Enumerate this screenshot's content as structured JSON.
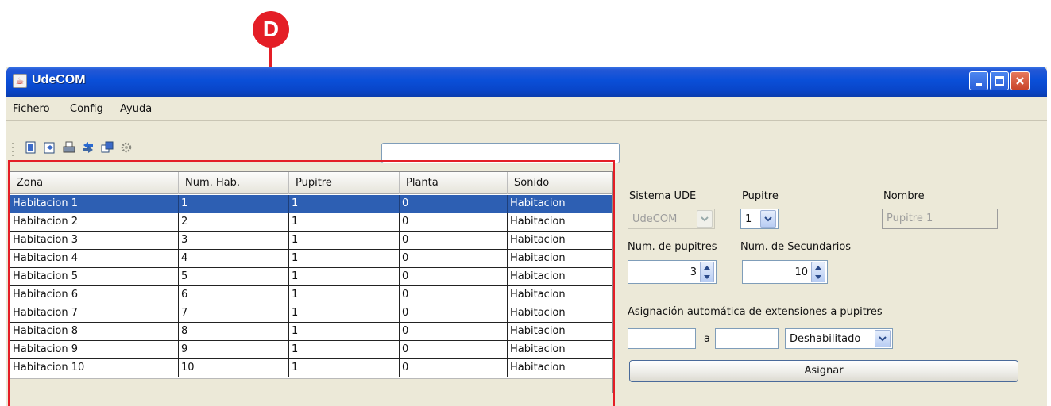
{
  "annotation": {
    "badge_label": "D"
  },
  "window": {
    "title": "UdeCOM",
    "controls": [
      "minimize-icon",
      "maximize-icon",
      "close-icon"
    ]
  },
  "menu": {
    "items": [
      "Fichero",
      "Config",
      "Ayuda"
    ]
  },
  "toolbar": {
    "icons": [
      "new-document-icon",
      "open-file-icon",
      "print-icon",
      "sync-icon",
      "windows-icon",
      "settings-icon"
    ]
  },
  "search": {
    "value": ""
  },
  "table": {
    "columns": [
      "Zona",
      "Num. Hab.",
      "Pupitre",
      "Planta",
      "Sonido"
    ],
    "rows": [
      [
        "Habitacion 1",
        "1",
        "1",
        "0",
        "Habitacion"
      ],
      [
        "Habitacion 2",
        "2",
        "1",
        "0",
        "Habitacion"
      ],
      [
        "Habitacion 3",
        "3",
        "1",
        "0",
        "Habitacion"
      ],
      [
        "Habitacion 4",
        "4",
        "1",
        "0",
        "Habitacion"
      ],
      [
        "Habitacion 5",
        "5",
        "1",
        "0",
        "Habitacion"
      ],
      [
        "Habitacion 6",
        "6",
        "1",
        "0",
        "Habitacion"
      ],
      [
        "Habitacion 7",
        "7",
        "1",
        "0",
        "Habitacion"
      ],
      [
        "Habitacion 8",
        "8",
        "1",
        "0",
        "Habitacion"
      ],
      [
        "Habitacion 9",
        "9",
        "1",
        "0",
        "Habitacion"
      ],
      [
        "Habitacion 10",
        "10",
        "1",
        "0",
        "Habitacion"
      ]
    ],
    "selected_row": 0
  },
  "panel": {
    "sistema_label": "Sistema UDE",
    "sistema_value": "UdeCOM",
    "pupitre_label": "Pupitre",
    "pupitre_value": "1",
    "nombre_label": "Nombre",
    "nombre_value": "Pupitre 1",
    "num_pupitres_label": "Num. de pupitres",
    "num_pupitres_value": "3",
    "num_secundarios_label": "Num. de Secundarios",
    "num_secundarios_value": "10",
    "asignacion_label": "Asignación automática de extensiones a pupitres",
    "range_from": "",
    "range_sep": "a",
    "range_to": "",
    "mode_value": "Deshabilitado",
    "asignar_label": "Asignar"
  },
  "colors": {
    "annotation": "#e41e26",
    "titlebar": "#0a4fd8",
    "selection": "#2d5fb3",
    "window_bg": "#ece9d8"
  }
}
